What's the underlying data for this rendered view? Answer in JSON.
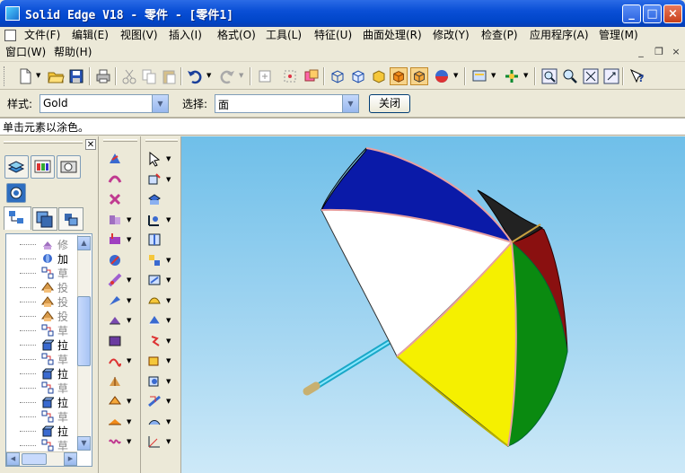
{
  "window": {
    "title": "Solid Edge V18 - 零件 - [零件1]",
    "minimize": "_",
    "maximize": "□",
    "close": "×"
  },
  "menu": {
    "row1": [
      {
        "label": "文件(F)"
      },
      {
        "label": "编辑(E)"
      },
      {
        "label": "视图(V)"
      },
      {
        "label": "插入(I)"
      },
      {
        "label": "格式(O)"
      },
      {
        "label": "工具(L)"
      },
      {
        "label": "特征(U)"
      },
      {
        "label": "曲面处理(R)"
      },
      {
        "label": "修改(Y)"
      },
      {
        "label": "检查(P)"
      },
      {
        "label": "应用程序(A)"
      },
      {
        "label": "管理(M)"
      }
    ],
    "row2": [
      {
        "label": "窗口(W)"
      },
      {
        "label": "帮助(H)"
      }
    ],
    "mdi_minimize": "_",
    "mdi_restore": "❐",
    "mdi_close": "×"
  },
  "ribbon": {
    "style_label": "样式:",
    "style_value": "Gold",
    "select_label": "选择:",
    "select_value": "面",
    "close_button": "关闭"
  },
  "prompt": "单击元素以涂色。",
  "tree": {
    "items": [
      {
        "label": "修",
        "icon": "protrusion-icon",
        "greyed": true
      },
      {
        "label": "加",
        "icon": "revolve-icon",
        "greyed": false
      },
      {
        "label": "草",
        "icon": "sketch-icon",
        "greyed": true
      },
      {
        "label": "投",
        "icon": "projection-icon",
        "greyed": true
      },
      {
        "label": "投",
        "icon": "projection-icon",
        "greyed": true
      },
      {
        "label": "投",
        "icon": "projection-icon",
        "greyed": true
      },
      {
        "label": "草",
        "icon": "sketch-icon",
        "greyed": true
      },
      {
        "label": "拉",
        "icon": "extrude-icon",
        "greyed": false
      },
      {
        "label": "草",
        "icon": "sketch-icon",
        "greyed": true
      },
      {
        "label": "拉",
        "icon": "extrude-icon",
        "greyed": false
      },
      {
        "label": "草",
        "icon": "sketch-icon",
        "greyed": true
      },
      {
        "label": "拉",
        "icon": "extrude-icon",
        "greyed": false
      },
      {
        "label": "草",
        "icon": "sketch-icon",
        "greyed": true
      },
      {
        "label": "拉",
        "icon": "extrude-icon",
        "greyed": false
      },
      {
        "label": "草",
        "icon": "sketch-icon",
        "greyed": true
      }
    ]
  },
  "colors": {
    "titlebar": "#0a4fd6",
    "viewport_top": "#6fbfe9",
    "panel_blue": "#0012a8",
    "panel_white": "#ffffff",
    "panel_yellow": "#f5f000",
    "panel_green": "#0a8a10",
    "panel_red": "#8a1010",
    "panel_black": "#1a1a1a",
    "handle": "#3ad0f0"
  }
}
